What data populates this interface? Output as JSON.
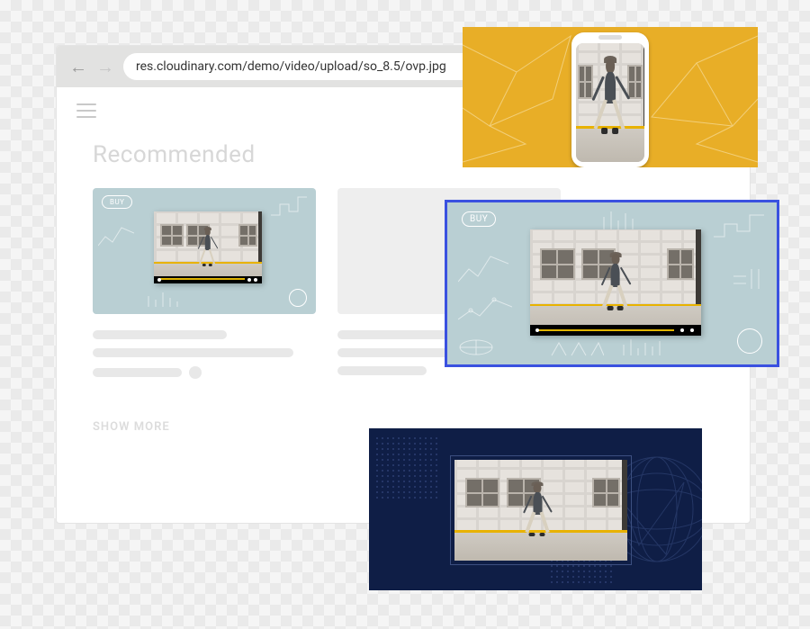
{
  "browser": {
    "url": "res.cloudinary.com/demo/video/upload/so_8.5/ovp.jpg",
    "menu_icon": "hamburger-icon",
    "back_icon": "arrow-left-icon",
    "forward_icon": "arrow-right-icon"
  },
  "page": {
    "heading": "Recommended",
    "show_more": "SHOW MORE",
    "cards": [
      {
        "buy_label": "BUY"
      },
      {
        "buy_label": ""
      }
    ]
  },
  "overlays": {
    "zoom_card": {
      "buy_label": "BUY",
      "highlight_color": "#3a51e0"
    },
    "yellow_panel": {
      "bg": "#e8ae27"
    },
    "navy_panel": {
      "bg": "#0f1e46"
    }
  }
}
